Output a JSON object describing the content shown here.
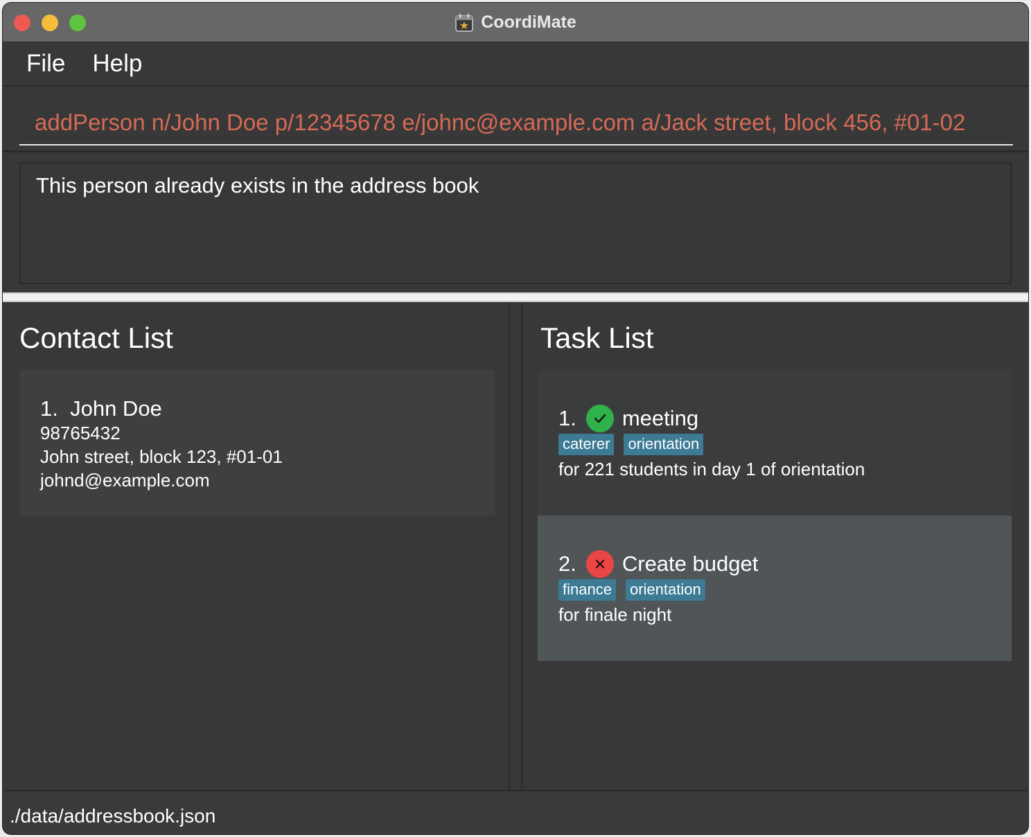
{
  "window": {
    "title": "CoordiMate",
    "app_icon": "calendar-icon"
  },
  "menu": {
    "items": [
      "File",
      "Help"
    ]
  },
  "command_box": {
    "value": "addPerson n/John Doe p/12345678 e/johnc@example.com a/Jack street, block 456, #01-02",
    "text_color": "#d56a56"
  },
  "result_display": {
    "text": "This person already exists in the address book"
  },
  "contacts": {
    "title": "Contact List",
    "items": [
      {
        "index": "1.",
        "name": "John Doe",
        "phone": "98765432",
        "address": "John street, block 123, #01-01",
        "email": "johnd@example.com"
      }
    ]
  },
  "tasks": {
    "title": "Task List",
    "items": [
      {
        "index": "1.",
        "title": "meeting",
        "status": "done",
        "status_icon": "check-circle-icon",
        "tags": [
          "caterer",
          "orientation"
        ],
        "description": "for 221 students in day 1 of orientation"
      },
      {
        "index": "2.",
        "title": "Create budget",
        "status": "not done",
        "status_icon": "x-circle-icon",
        "tags": [
          "finance",
          "orientation"
        ],
        "description": "for finale night"
      }
    ]
  },
  "status_bar": {
    "path": "./data/addressbook.json"
  },
  "colors": {
    "tag_bg": "#3d7a94",
    "done_green": "#2fb24a",
    "undone_red": "#ec4545",
    "selected_card": "#505558"
  }
}
